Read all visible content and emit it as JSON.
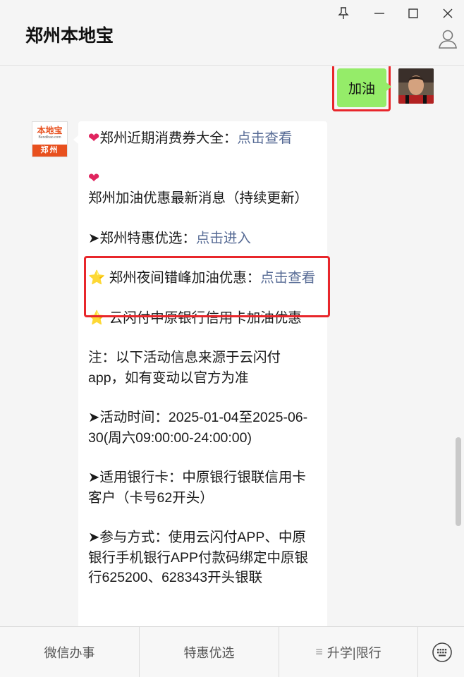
{
  "window": {
    "title": "郑州本地宝",
    "controls": [
      "pin-icon",
      "minimize-icon",
      "maximize-icon",
      "close-icon"
    ]
  },
  "chat": {
    "outgoing": {
      "text": "加油"
    },
    "incoming": {
      "avatar": {
        "logo_name": "本地宝",
        "logo_url": "Bendibao.com",
        "logo_city": "郑州"
      },
      "blocks": [
        {
          "prefix": "❤",
          "text": "郑州近期消费券大全：",
          "link": "点击查看"
        },
        {
          "prefix": "❤",
          "text": "郑州加油优惠最新消息（持续更新）"
        },
        {
          "prefix": "➤",
          "text": "郑州特惠优选：",
          "link": "点击进入"
        },
        {
          "prefix": "⭐",
          "text": " 郑州夜间错峰加油优惠：",
          "link": "点击查看"
        },
        {
          "prefix": "⭐",
          "text": " 云闪付中原银行信用卡加油优惠"
        },
        {
          "text": "注：以下活动信息来源于云闪付app，如有变动以官方为准"
        },
        {
          "prefix": "➤",
          "text": "活动时间：2025-01-04至2025-06-30(周六09:00:00-24:00:00)"
        },
        {
          "prefix": "➤",
          "text": "适用银行卡：中原银行银联信用卡客户（卡号62开头）"
        },
        {
          "prefix": "➤",
          "text": "参与方式：使用云闪付APP、中原银行手机银行APP付款码绑定中原银行625200、628343开头银联"
        }
      ]
    }
  },
  "menu": {
    "items": [
      "微信办事",
      "特惠优选",
      "升学|限行"
    ],
    "burger": "≡"
  },
  "colors": {
    "highlight": "#e8262b",
    "outgoing_bubble": "#95ec69",
    "link": "#576b95"
  }
}
